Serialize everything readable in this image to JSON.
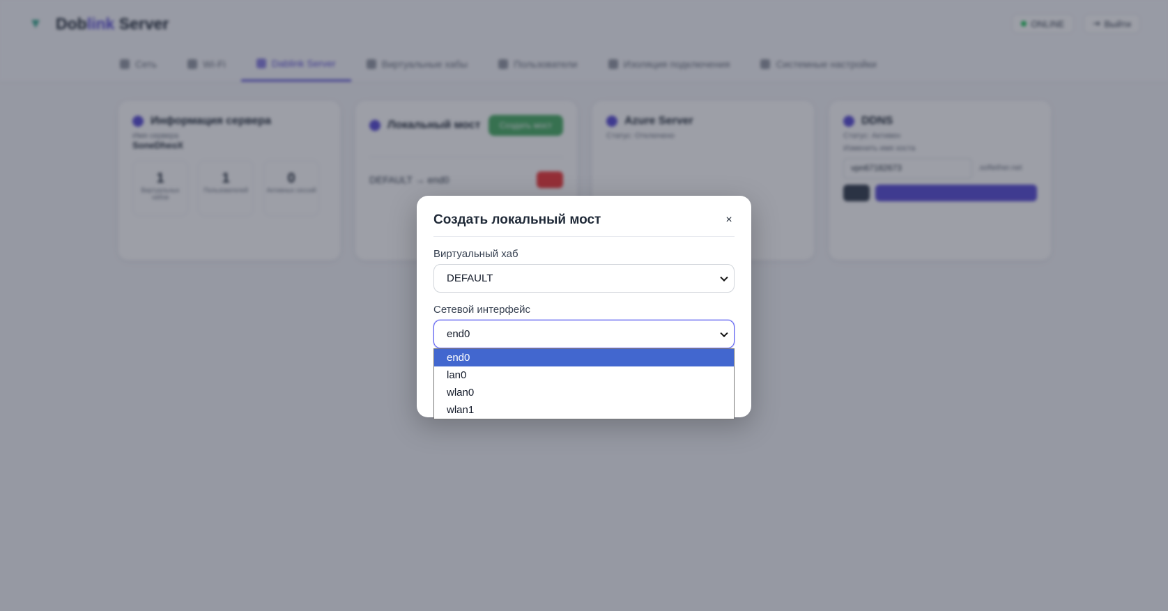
{
  "app": {
    "brand_part1": "Dob",
    "brand_accent": "link",
    "brand_part2": " Server",
    "status_label": "ONLINE",
    "logout_label": "Выйти"
  },
  "tabs": [
    {
      "label": "Сеть"
    },
    {
      "label": "Wi-Fi"
    },
    {
      "label": "Dablink Server"
    },
    {
      "label": "Виртуальные хабы"
    },
    {
      "label": "Пользователи"
    },
    {
      "label": "Изоляция подключения"
    },
    {
      "label": "Системные настройки"
    }
  ],
  "cards": {
    "server_info": {
      "title": "Информация сервера",
      "name_label": "Имя сервера",
      "name_value": "SoneDheoX",
      "stats": [
        {
          "num": "1",
          "cap": "Виртуальных хабов"
        },
        {
          "num": "1",
          "cap": "Пользователей"
        },
        {
          "num": "0",
          "cap": "Активных сессий"
        }
      ]
    },
    "local_bridge": {
      "title": "Локальный мост",
      "add_label": "Создать мост",
      "bridge_entry": "DEFAULT → end0"
    },
    "azure": {
      "title": "Azure Server",
      "status": "Статус: Отключено"
    },
    "ddns": {
      "title": "DDNS",
      "status": "Статус: Активен",
      "change_label": "Изменить имя хоста",
      "host_value": "vpn67182673",
      "suffix": ".softether.net"
    }
  },
  "modal": {
    "title": "Создать локальный мост",
    "close_label": "×",
    "hub_label": "Виртуальный хаб",
    "hub_value": "DEFAULT",
    "iface_label": "Сетевой интерфейс",
    "iface_value": "end0",
    "options": [
      "end0",
      "lan0",
      "wlan0",
      "wlan1"
    ],
    "selected_index": 0
  },
  "colors": {
    "accent": "#5b4fd6",
    "selected_option": "#4267cf",
    "overlay": "rgba(28,33,52,0.43)"
  }
}
